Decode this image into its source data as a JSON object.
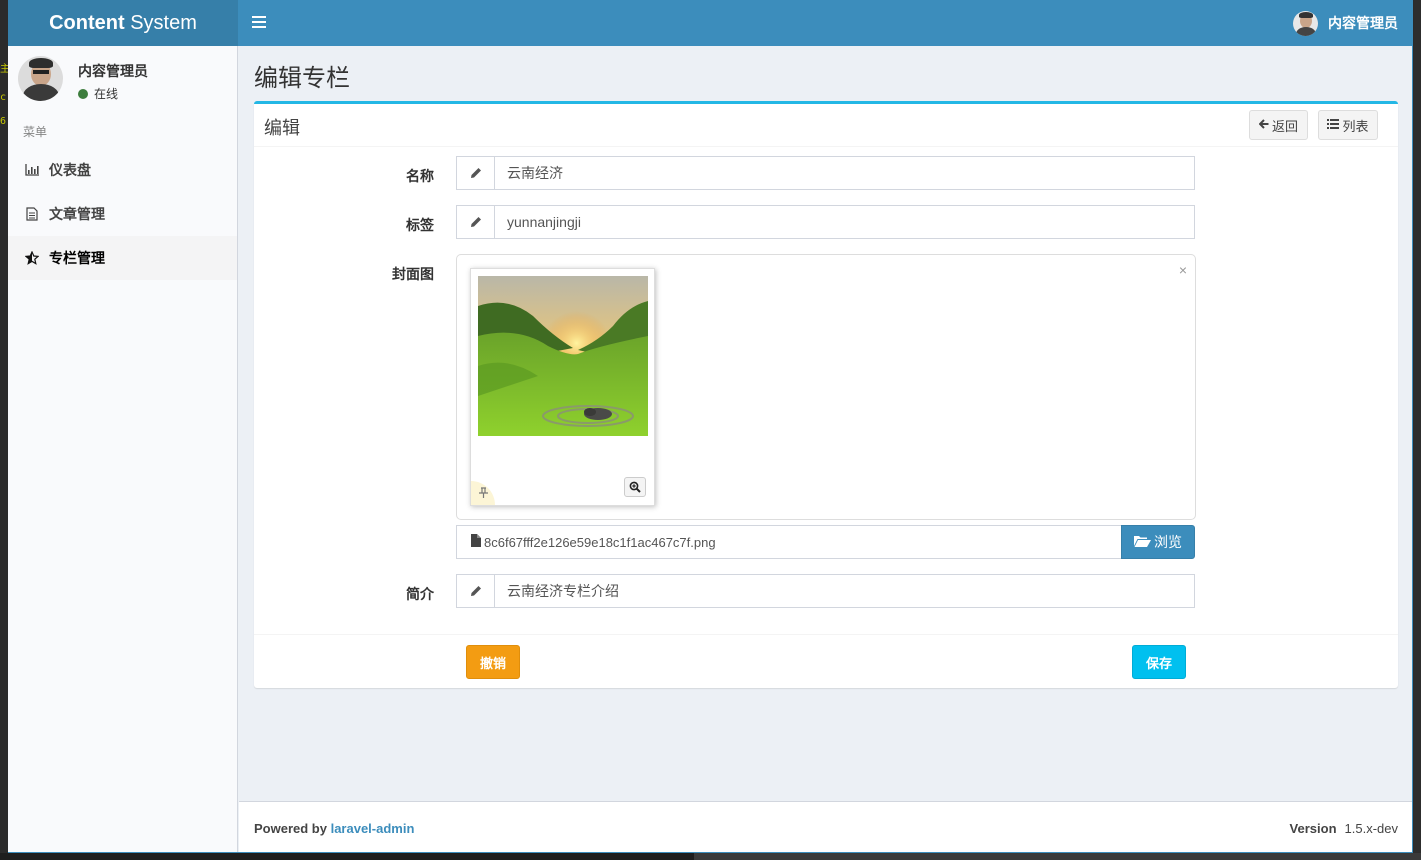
{
  "app": {
    "logo_bold": "Content",
    "logo_rest": " System"
  },
  "header": {
    "user_name": "内容管理员"
  },
  "sidebar": {
    "user_name": "内容管理员",
    "status": "在线",
    "menu_header": "菜单",
    "items": [
      {
        "label": "仪表盘",
        "icon": "bar-chart-icon"
      },
      {
        "label": "文章管理",
        "icon": "file-text-icon"
      },
      {
        "label": "专栏管理",
        "icon": "star-half-icon",
        "active": true
      }
    ]
  },
  "page": {
    "title": "编辑专栏"
  },
  "box": {
    "title": "编辑",
    "back_label": "返回",
    "list_label": "列表"
  },
  "form": {
    "name_label": "名称",
    "name_value": "云南经济",
    "tag_label": "标签",
    "tag_value": "yunnanjingji",
    "cover_label": "封面图",
    "cover_file": "8c6f67fff2e126e59e18c1f1ac467c7f.png",
    "browse_label": "浏览",
    "intro_label": "简介",
    "intro_value": "云南经济专栏介绍"
  },
  "actions": {
    "reset_label": "撤销",
    "save_label": "保存"
  },
  "footer": {
    "powered_prefix": "Powered by ",
    "powered_link": "laravel-admin",
    "version_label": "Version",
    "version_value": "1.5.x-dev"
  },
  "colors": {
    "header": "#3c8dbc",
    "logo_bg": "#367fa9",
    "box_border": "#23b7e5",
    "reset": "#f39c12",
    "save": "#00c0ef"
  }
}
